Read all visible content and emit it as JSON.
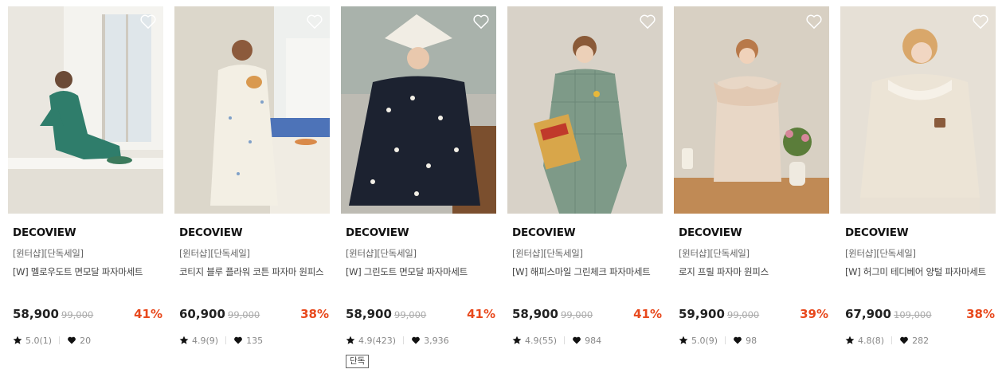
{
  "products": [
    {
      "brand": "DECOVIEW",
      "tag": "[윈터샵][단독세일]",
      "name": "[W] 멜로우도트 면모달 파자마세트",
      "price": "58,900",
      "original_price": "99,000",
      "discount": "41%",
      "rating": "5.0(1)",
      "likes": "20",
      "badge": "",
      "photo_icon": "model-green-dotted-pajama-photo",
      "colors": {
        "bg": "#e9e6df",
        "outfit": "#2f7d6b"
      }
    },
    {
      "brand": "DECOVIEW",
      "tag": "[윈터샵][단독세일]",
      "name": "코티지 블루 플라워 코튼 파자마 원피스",
      "price": "60,900",
      "original_price": "99,000",
      "discount": "38%",
      "rating": "4.9(9)",
      "likes": "135",
      "badge": "",
      "photo_icon": "model-floral-nightgown-kitchen-photo",
      "colors": {
        "bg": "#dcd6c8",
        "outfit": "#f3efe4"
      }
    },
    {
      "brand": "DECOVIEW",
      "tag": "[윈터샵][단독세일]",
      "name": "[W] 그린도트 면모달 파자마세트",
      "price": "58,900",
      "original_price": "99,000",
      "discount": "41%",
      "rating": "4.9(423)",
      "likes": "3,936",
      "badge": "단독",
      "photo_icon": "model-navy-dot-pajama-book-photo",
      "colors": {
        "bg": "#b9b7ae",
        "outfit": "#1c2230"
      }
    },
    {
      "brand": "DECOVIEW",
      "tag": "[윈터샵][단독세일]",
      "name": "[W] 해피스마일 그린체크 파자마세트",
      "price": "58,900",
      "original_price": "99,000",
      "discount": "41%",
      "rating": "4.9(55)",
      "likes": "984",
      "badge": "",
      "photo_icon": "model-green-check-pajama-cereal-photo",
      "colors": {
        "bg": "#d6d0c6",
        "outfit": "#7e9a88"
      }
    },
    {
      "brand": "DECOVIEW",
      "tag": "[윈터샵][단독세일]",
      "name": "로지 프릴 파자마 원피스",
      "price": "59,900",
      "original_price": "99,000",
      "discount": "39%",
      "rating": "5.0(9)",
      "likes": "98",
      "badge": "",
      "photo_icon": "model-rosy-frill-dress-flowers-photo",
      "colors": {
        "bg": "#d9d1c4",
        "outfit": "#e8d7c6"
      }
    },
    {
      "brand": "DECOVIEW",
      "tag": "[윈터샵][단독세일]",
      "name": "[W] 허그미 테디베어 양털 파자마세트",
      "price": "67,900",
      "original_price": "109,000",
      "discount": "38%",
      "rating": "4.8(8)",
      "likes": "282",
      "badge": "",
      "photo_icon": "model-teddy-fleece-pajama-photo",
      "colors": {
        "bg": "#e7e1d7",
        "outfit": "#ece4d6"
      }
    }
  ]
}
